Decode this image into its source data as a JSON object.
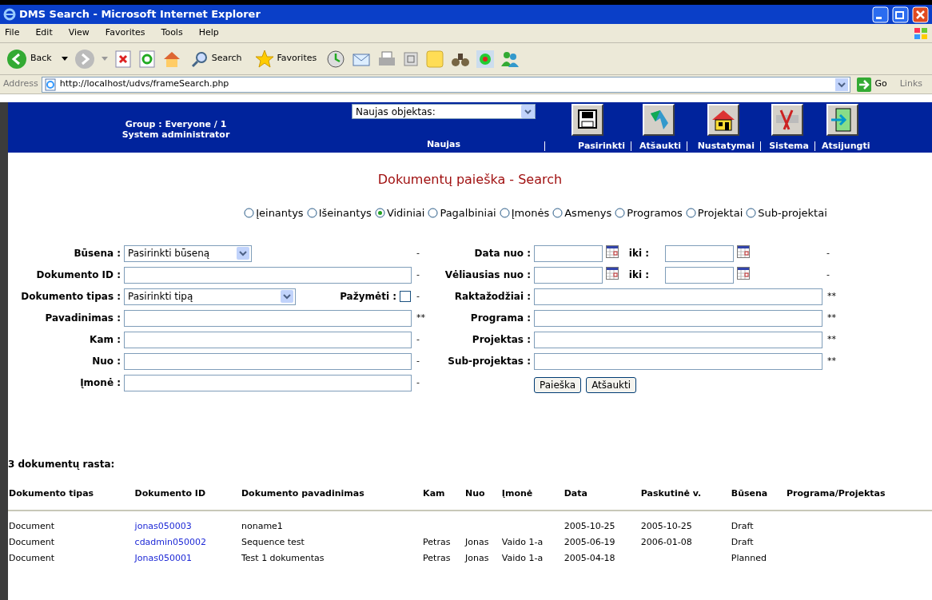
{
  "window": {
    "title": "DMS Search - Microsoft Internet Explorer"
  },
  "menu": [
    "File",
    "Edit",
    "View",
    "Favorites",
    "Tools",
    "Help"
  ],
  "toolbar": {
    "back": "Back",
    "search": "Search",
    "favorites": "Favorites"
  },
  "address": {
    "label": "Address",
    "url": "http://localhost/udvs/frameSearch.php",
    "go": "Go",
    "links": "Links"
  },
  "header": {
    "group": "Group : Everyone / 1",
    "role": "System administrator",
    "new_object": "Naujas objektas:",
    "new_label": "Naujas",
    "nav": [
      {
        "label": "Pasirinkti",
        "kind": "save"
      },
      {
        "label": "Atšaukti",
        "kind": "undo"
      },
      {
        "label": "Nustatymai",
        "kind": "home"
      },
      {
        "label": "Sistema",
        "kind": "tools"
      },
      {
        "label": "Atsijungti",
        "kind": "exit"
      }
    ]
  },
  "page": {
    "title": "Dokumentų paieška - Search",
    "radios": [
      {
        "label": "Įeinantys",
        "selected": false
      },
      {
        "label": "Išeinantys",
        "selected": false
      },
      {
        "label": "Vidiniai",
        "selected": true
      },
      {
        "label": "Pagalbiniai",
        "selected": false
      },
      {
        "label": "Įmonės",
        "selected": false
      },
      {
        "label": "Asmenys",
        "selected": false
      },
      {
        "label": "Programos",
        "selected": false
      },
      {
        "label": "Projektai",
        "selected": false
      },
      {
        "label": "Sub-projektai",
        "selected": false
      }
    ],
    "left_fields": [
      {
        "label": "Būsena :",
        "kind": "select",
        "value": "Pasirinkti būseną",
        "suffix": "-"
      },
      {
        "label": "Dokumento ID :",
        "kind": "text",
        "suffix": "-"
      },
      {
        "label": "Dokumento tipas :",
        "kind": "select_check",
        "value": "Pasirinkti tipą",
        "check_label": "Pažymėti :",
        "checked": false,
        "suffix": "-"
      },
      {
        "label": "Pavadinimas :",
        "kind": "text",
        "suffix": "**"
      },
      {
        "label": "Kam :",
        "kind": "text",
        "suffix": "-"
      },
      {
        "label": "Nuo :",
        "kind": "text",
        "suffix": "-"
      },
      {
        "label": "Įmonė :",
        "kind": "text",
        "suffix": "-"
      }
    ],
    "right_fields": [
      {
        "label": "Data nuo :",
        "kind": "date_range",
        "to_label": "iki :",
        "suffix": "-"
      },
      {
        "label": "Vėliausias nuo :",
        "kind": "date_range",
        "to_label": "iki :",
        "suffix": "-"
      },
      {
        "label": "Raktažodžiai :",
        "kind": "text",
        "suffix": "**"
      },
      {
        "label": "Programa :",
        "kind": "text",
        "suffix": "**"
      },
      {
        "label": "Projektas :",
        "kind": "text",
        "suffix": "**"
      },
      {
        "label": "Sub-projektas :",
        "kind": "text",
        "suffix": "**"
      }
    ],
    "buttons": [
      "Paieška",
      "Atšaukti"
    ]
  },
  "results": {
    "heading": "3 dokumentų rasta:",
    "columns": [
      "Dokumento tipas",
      "Dokumento ID",
      "Dokumento pavadinimas",
      "Kam",
      "Nuo",
      "Įmonė",
      "Data",
      "Paskutinė v.",
      "Būsena",
      "Programa/Projektas"
    ],
    "rows": [
      [
        "Document",
        "jonas050003",
        "noname1",
        "",
        "",
        "",
        "2005-10-25",
        "2005-10-25",
        "Draft",
        ""
      ],
      [
        "Document",
        "cdadmin050002",
        "Sequence test",
        "Petras",
        "Jonas",
        "Vaido 1-a",
        "2005-06-19",
        "2006-01-08",
        "Draft",
        ""
      ],
      [
        "Document",
        "Jonas050001",
        "Test 1 dokumentas",
        "Petras",
        "Jonas",
        "Vaido 1-a",
        "2005-04-18",
        "",
        "Planned",
        ""
      ]
    ]
  }
}
